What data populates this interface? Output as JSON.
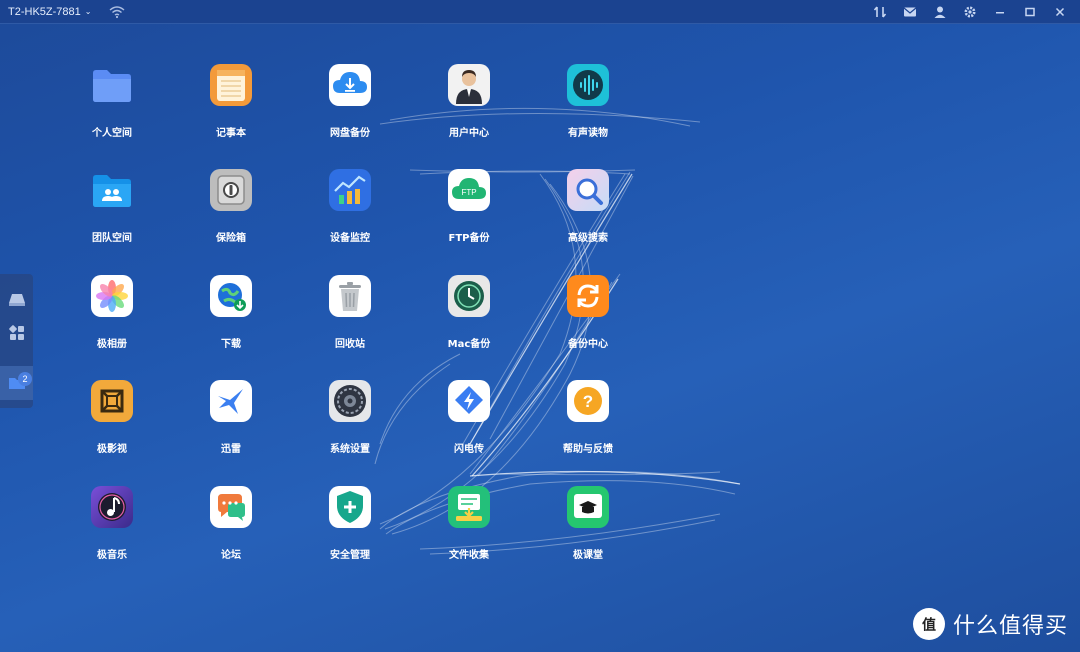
{
  "titlebar": {
    "device_name": "T2-HK5Z-7881",
    "device_chevron": "⌄",
    "icons": [
      "wifi-icon",
      "transfer-icon",
      "mail-icon",
      "user-icon",
      "gear-icon",
      "minimize-icon",
      "maximize-icon",
      "close-icon"
    ]
  },
  "dock": {
    "items": [
      {
        "name": "storage-icon"
      },
      {
        "name": "apps-grid-icon"
      },
      {
        "name": "folder-icon",
        "badge": "2"
      }
    ]
  },
  "apps": [
    {
      "label": "个人空间",
      "icon": "folder-icon",
      "color": "#5b8cf4"
    },
    {
      "label": "记事本",
      "icon": "notepad-icon",
      "color": "#f39a3a"
    },
    {
      "label": "网盘备份",
      "icon": "cloud-download-icon",
      "color": "#ffffff"
    },
    {
      "label": "用户中心",
      "icon": "person-icon",
      "color": "#f2f2f2"
    },
    {
      "label": "有声读物",
      "icon": "audio-wave-icon",
      "color": "#1ec0d8"
    },
    {
      "label": "团队空间",
      "icon": "team-folder-icon",
      "color": "#2aa6f5"
    },
    {
      "label": "保险箱",
      "icon": "safe-icon",
      "color": "#bdbdbd"
    },
    {
      "label": "设备监控",
      "icon": "chart-icon",
      "color": "#2f6fe3"
    },
    {
      "label": "FTP备份",
      "icon": "ftp-cloud-icon",
      "color": "#ffffff"
    },
    {
      "label": "高级搜索",
      "icon": "advanced-search-icon",
      "color": "#dfe8f8"
    },
    {
      "label": "极相册",
      "icon": "photos-icon",
      "color": "#ffffff"
    },
    {
      "label": "下载",
      "icon": "globe-download-icon",
      "color": "#ffffff"
    },
    {
      "label": "回收站",
      "icon": "trash-icon",
      "color": "#ffffff"
    },
    {
      "label": "Mac备份",
      "icon": "time-machine-icon",
      "color": "#e8e8e8"
    },
    {
      "label": "备份中心",
      "icon": "sync-icon",
      "color": "#ff8a1c"
    },
    {
      "label": "极影视",
      "icon": "video-icon",
      "color": "#f2a93b"
    },
    {
      "label": "迅雷",
      "icon": "thunder-bird-icon",
      "color": "#ffffff"
    },
    {
      "label": "系统设置",
      "icon": "settings-icon",
      "color": "#e5e7ea"
    },
    {
      "label": "闪电传",
      "icon": "flash-transfer-icon",
      "color": "#ffffff"
    },
    {
      "label": "帮助与反馈",
      "icon": "help-icon",
      "color": "#ffffff"
    },
    {
      "label": "极音乐",
      "icon": "music-icon",
      "color": "#5c3da8"
    },
    {
      "label": "论坛",
      "icon": "forum-icon",
      "color": "#ffffff"
    },
    {
      "label": "安全管理",
      "icon": "shield-icon",
      "color": "#ffffff"
    },
    {
      "label": "文件收集",
      "icon": "file-collect-icon",
      "color": "#23c07a"
    },
    {
      "label": "极课堂",
      "icon": "graduation-icon",
      "color": "#25c76f"
    }
  ],
  "watermark": {
    "text": "什么值得买",
    "logo_char": "值"
  }
}
